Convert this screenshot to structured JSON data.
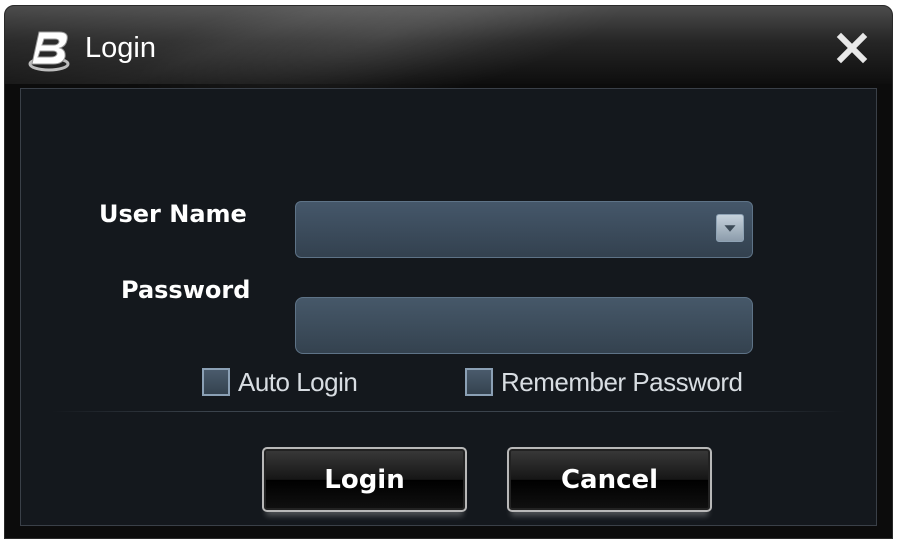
{
  "window": {
    "title": "Login",
    "logo_icon": "b-logo-icon",
    "close_icon": "close-icon"
  },
  "form": {
    "username_label": "User Name",
    "username_value": "",
    "password_label": "Password",
    "password_value": ""
  },
  "options": {
    "auto_login_label": "Auto Login",
    "auto_login_checked": false,
    "remember_password_label": "Remember Password",
    "remember_password_checked": false
  },
  "buttons": {
    "login_label": "Login",
    "cancel_label": "Cancel"
  },
  "colors": {
    "window_bg": "#0c0c0c",
    "panel_bg": "#14181d",
    "input_bg": "#3c4b5b",
    "input_border": "#5e7387",
    "text": "#ffffff"
  }
}
